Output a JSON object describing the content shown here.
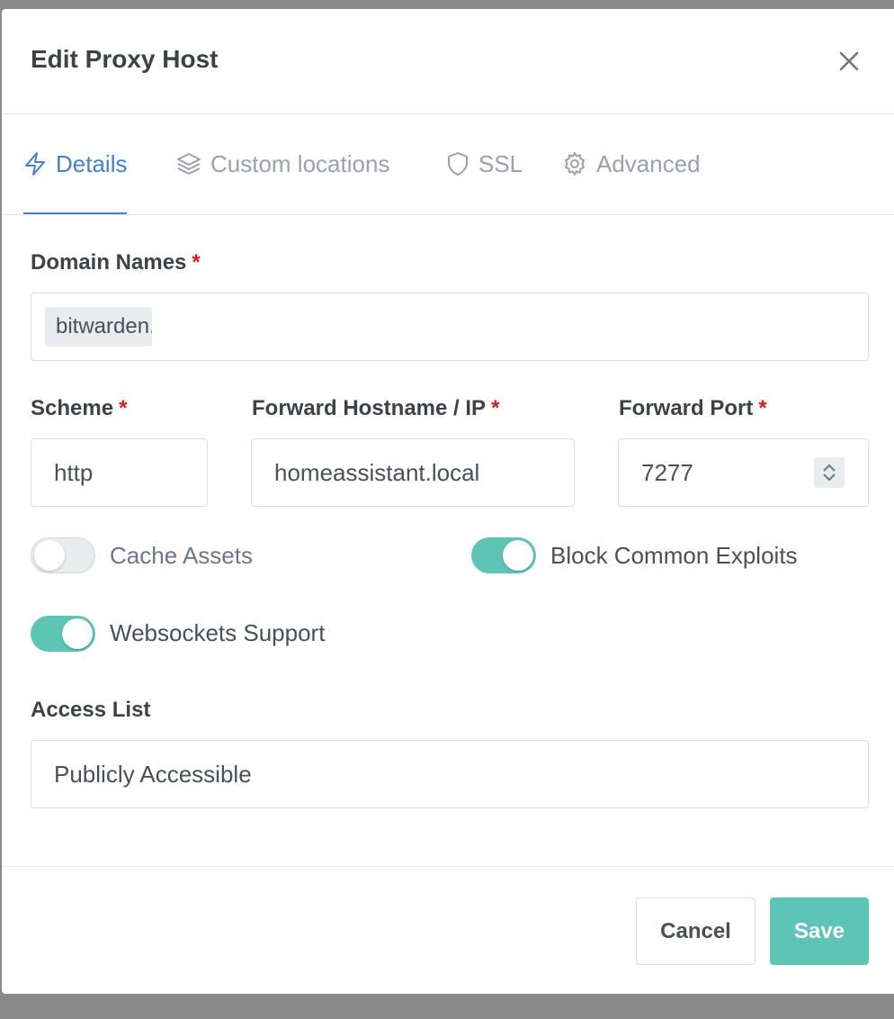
{
  "modal": {
    "title": "Edit Proxy Host",
    "close_icon": "close-icon"
  },
  "tabs": [
    {
      "label": "Details",
      "icon": "bolt-icon",
      "active": true
    },
    {
      "label": "Custom locations",
      "icon": "layers-icon",
      "active": false
    },
    {
      "label": "SSL",
      "icon": "shield-icon",
      "active": false
    },
    {
      "label": "Advanced",
      "icon": "gear-icon",
      "active": false
    }
  ],
  "form": {
    "domain_names": {
      "label": "Domain Names",
      "required_mark": "*",
      "tag_value": "bitwarden.d"
    },
    "scheme": {
      "label": "Scheme",
      "required_mark": "*",
      "value": "http"
    },
    "forward_host": {
      "label": "Forward Hostname / IP",
      "required_mark": "*",
      "value": "homeassistant.local"
    },
    "forward_port": {
      "label": "Forward Port",
      "required_mark": "*",
      "value": "7277"
    },
    "toggles": {
      "cache_assets": {
        "label": "Cache Assets",
        "enabled": false
      },
      "block_exploits": {
        "label": "Block Common Exploits",
        "enabled": true
      },
      "websockets": {
        "label": "Websockets Support",
        "enabled": true
      }
    },
    "access_list": {
      "label": "Access List",
      "value": "Publicly Accessible"
    }
  },
  "footer": {
    "cancel_label": "Cancel",
    "save_label": "Save"
  },
  "colors": {
    "accent": "#467fcf",
    "toggle_on": "#5ec4b6",
    "save_button": "#5ec4b6",
    "required": "#cd201f"
  }
}
